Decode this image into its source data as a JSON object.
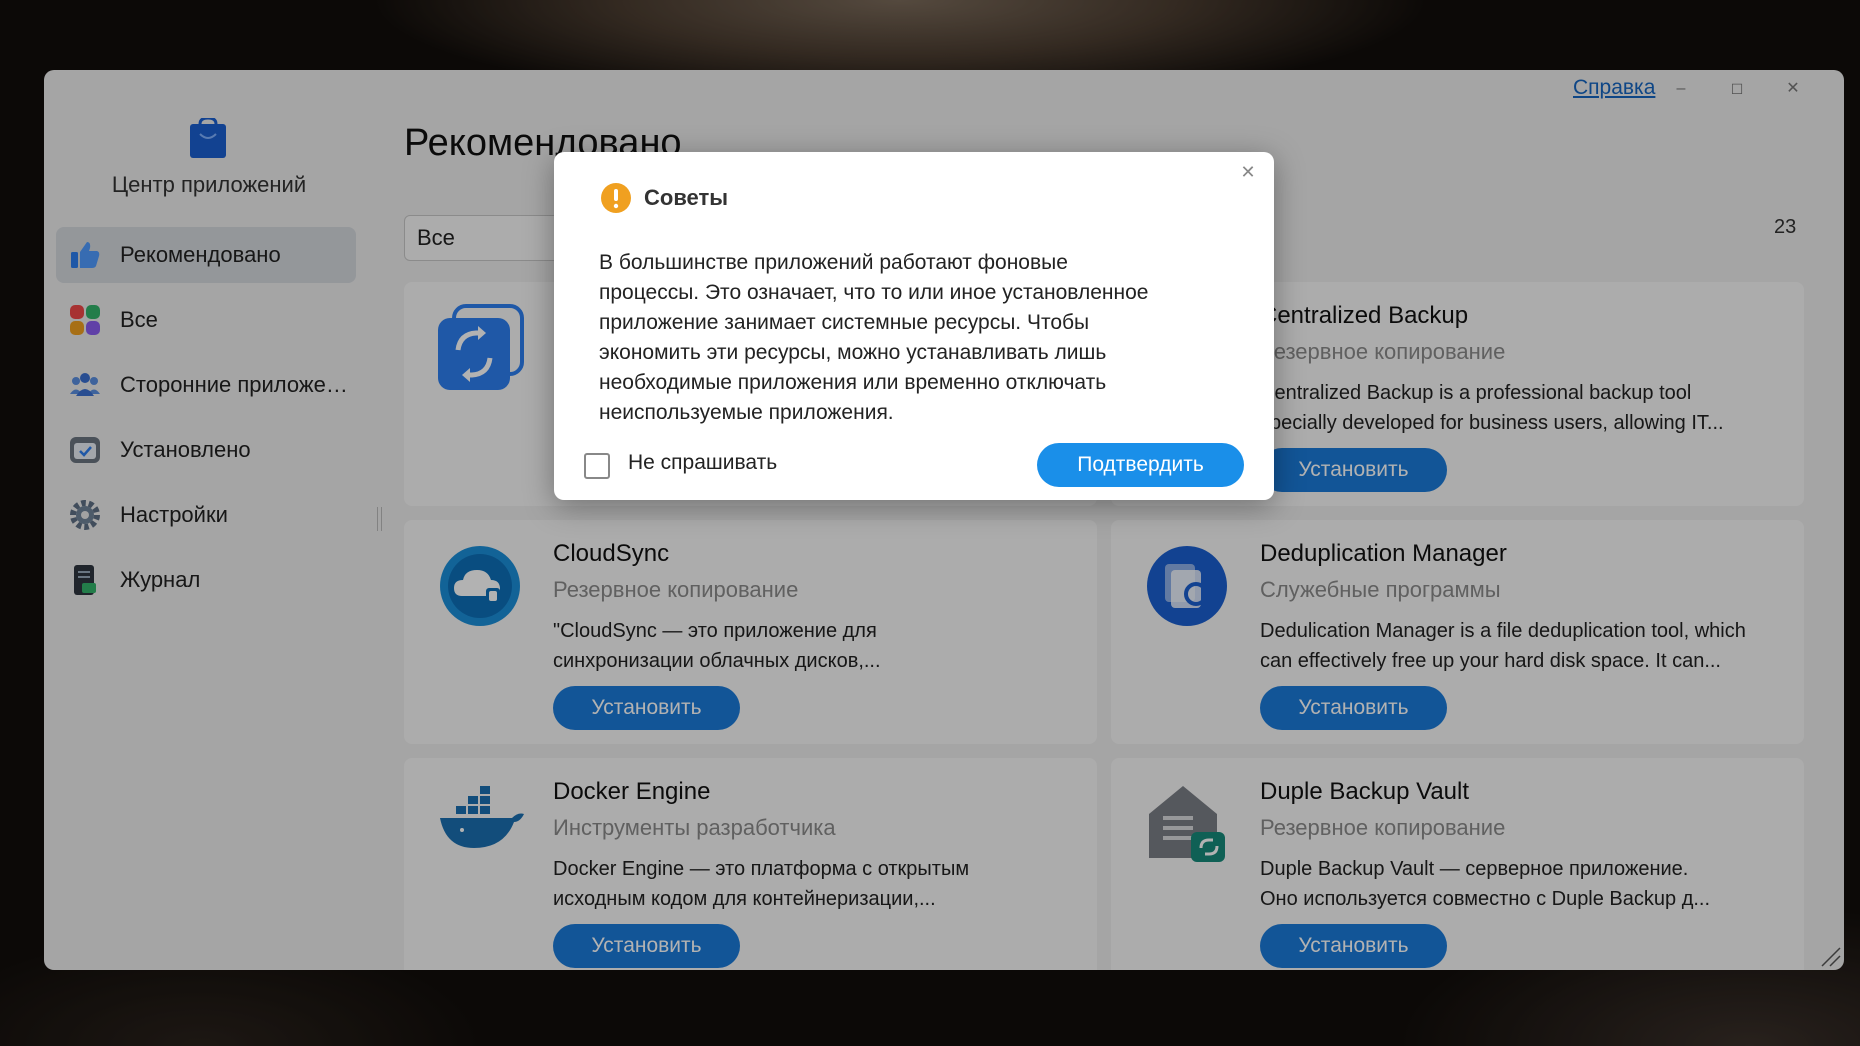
{
  "window": {
    "help_label": "Справка",
    "minimize": "–",
    "maximize": "☐",
    "close": "✕"
  },
  "sidebar": {
    "app_name": "Центр приложений",
    "items": [
      {
        "label": "Рекомендовано",
        "icon": "thumbs-up-icon",
        "active": true
      },
      {
        "label": "Все",
        "icon": "grid-icon"
      },
      {
        "label": "Сторонние приложения",
        "icon": "users-icon"
      },
      {
        "label": "Установлено",
        "icon": "installed-box-icon"
      },
      {
        "label": "Настройки",
        "icon": "gear-icon"
      },
      {
        "label": "Журнал",
        "icon": "log-icon"
      }
    ]
  },
  "main": {
    "title": "Рекомендовано",
    "filter_value": "Все",
    "count": "23",
    "install_label": "Установить",
    "cards": [
      {
        "title": "",
        "category": "",
        "desc1": "",
        "desc2": ""
      },
      {
        "title": "Centralized Backup",
        "category": "Резервное копирование",
        "desc1": "Centralized Backup is a professional backup tool",
        "desc2": "specially developed for business users, allowing IT..."
      },
      {
        "title": "CloudSync",
        "category": "Резервное копирование",
        "desc1": "\"CloudSync — это приложение для",
        "desc2": "синхронизации облачных дисков,..."
      },
      {
        "title": "Deduplication Manager",
        "category": "Служебные программы",
        "desc1": "Dedulication Manager is a file deduplication tool, which",
        "desc2": "can effectively free up your hard disk space. It can..."
      },
      {
        "title": "Docker Engine",
        "category": "Инструменты разработчика",
        "desc1": "Docker Engine — это платформа с открытым",
        "desc2": "исходным кодом для контейнеризации,..."
      },
      {
        "title": "Duple Backup Vault",
        "category": "Резервное копирование",
        "desc1": "Duple Backup Vault — серверное приложение.",
        "desc2": "Оно используется совместно с Duple Backup д..."
      }
    ]
  },
  "dialog": {
    "title": "Советы",
    "close": "✕",
    "lines": [
      "В большинстве приложений работают фоновые",
      "процессы. Это означает, что то или иное установленное",
      "приложение занимает системные ресурсы. Чтобы",
      "экономить эти ресурсы, можно устанавливать лишь",
      "необходимые приложения или временно отключать",
      "неиспользуемые приложения."
    ],
    "checkbox_label": "Не спрашивать",
    "confirm_label": "Подтвердить"
  },
  "colors": {
    "accent": "#1a7ad9",
    "warning": "#f0a020"
  }
}
